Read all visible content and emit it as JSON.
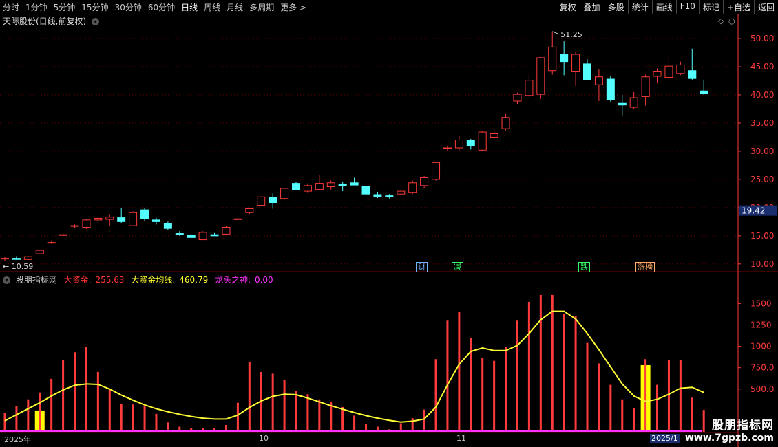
{
  "toolbar": {
    "periods": [
      "分时",
      "1分钟",
      "5分钟",
      "15分钟",
      "30分钟",
      "60分钟",
      "日线",
      "周线",
      "月线",
      "多周期",
      "更多 >"
    ],
    "active_period": "日线",
    "right_buttons": [
      "复权",
      "叠加",
      "多股",
      "统计",
      "画线",
      "F10",
      "标记",
      "+自选",
      "返回"
    ]
  },
  "chart_title": "天际股份(日线,前复权)",
  "indicator": {
    "name": "股朋指标网",
    "line1_label": "大资金:",
    "line1_value": "255.63",
    "line2_label": "大资金均线:",
    "line2_value": "460.79",
    "line3_label": "龙头之神:",
    "line3_value": "0.00"
  },
  "annotations": {
    "high": "51.25",
    "low": "10.59",
    "current_price": "19.42"
  },
  "event_tags": [
    "财",
    "减",
    "跌",
    "涨榜"
  ],
  "date_labels": [
    "2025年",
    "10",
    "11",
    "2025/1"
  ],
  "watermark": {
    "line1": "股朋指标网",
    "line2": "www.7gpzb.com"
  },
  "colors": {
    "up": "#ff3b3b",
    "down": "#54ffff",
    "line": "#ffff33",
    "highlight": "#ffff00",
    "axis": "#ff3b3b"
  },
  "chart_data": [
    {
      "type": "candlestick",
      "title": "天际股份(日线,前复权)",
      "yticks": [
        10,
        15,
        20,
        25,
        30,
        35,
        40,
        45,
        50
      ],
      "ylim": [
        9.0,
        52.2
      ],
      "ohlc": [
        [
          10.9,
          11.2,
          10.59,
          11.0
        ],
        [
          11.0,
          11.4,
          10.7,
          10.8
        ],
        [
          10.8,
          11.4,
          10.7,
          11.3
        ],
        [
          11.8,
          12.5,
          11.7,
          12.4
        ],
        [
          13.8,
          14.0,
          13.6,
          13.8
        ],
        [
          15.2,
          15.4,
          15.0,
          15.2
        ],
        [
          16.7,
          17.0,
          16.4,
          16.8
        ],
        [
          16.5,
          17.9,
          16.2,
          17.8
        ],
        [
          17.8,
          18.3,
          17.3,
          18.1
        ],
        [
          17.9,
          18.8,
          16.8,
          18.3
        ],
        [
          18.2,
          19.9,
          17.3,
          17.5
        ],
        [
          16.8,
          19.3,
          16.8,
          19.1
        ],
        [
          19.6,
          19.9,
          17.6,
          18.0
        ],
        [
          17.8,
          18.2,
          17.0,
          17.5
        ],
        [
          17.2,
          17.5,
          16.0,
          16.3
        ],
        [
          15.4,
          15.8,
          15.0,
          15.3
        ],
        [
          15.1,
          15.3,
          14.6,
          14.7
        ],
        [
          14.3,
          15.8,
          14.3,
          15.6
        ],
        [
          15.2,
          15.5,
          15.0,
          15.0
        ],
        [
          15.3,
          16.7,
          15.1,
          16.5
        ],
        [
          17.9,
          18.2,
          17.8,
          18.0
        ],
        [
          19.1,
          20.0,
          18.9,
          19.8
        ],
        [
          20.4,
          22.0,
          20.3,
          21.9
        ],
        [
          21.8,
          22.5,
          19.8,
          20.9
        ],
        [
          21.6,
          23.5,
          21.4,
          23.4
        ],
        [
          24.3,
          24.6,
          23.1,
          23.2
        ],
        [
          22.9,
          24.3,
          22.7,
          23.9
        ],
        [
          23.2,
          25.8,
          23.2,
          24.3
        ],
        [
          23.7,
          24.8,
          23.2,
          24.4
        ],
        [
          24.2,
          24.6,
          22.9,
          23.9
        ],
        [
          24.4,
          25.3,
          24.1,
          24.0
        ],
        [
          23.8,
          24.1,
          22.2,
          22.4
        ],
        [
          22.3,
          22.8,
          21.7,
          22.0
        ],
        [
          22.1,
          22.4,
          21.6,
          22.0
        ],
        [
          22.4,
          23.0,
          22.2,
          22.9
        ],
        [
          22.7,
          24.8,
          22.4,
          24.4
        ],
        [
          23.9,
          25.6,
          23.5,
          25.3
        ],
        [
          25.0,
          28.0,
          24.8,
          28.0
        ],
        [
          30.5,
          31.0,
          30.0,
          30.6
        ],
        [
          30.6,
          32.7,
          30.0,
          32.0
        ],
        [
          32.0,
          32.2,
          30.3,
          30.9
        ],
        [
          30.2,
          33.6,
          30.0,
          33.4
        ],
        [
          32.5,
          34.0,
          32.2,
          33.1
        ],
        [
          34.0,
          36.6,
          33.7,
          36.0
        ],
        [
          38.9,
          40.4,
          38.4,
          40.1
        ],
        [
          39.9,
          43.8,
          39.4,
          42.6
        ],
        [
          40.1,
          46.7,
          39.3,
          46.6
        ],
        [
          44.3,
          51.25,
          43.6,
          48.5
        ],
        [
          47.2,
          49.5,
          43.5,
          45.9
        ],
        [
          44.2,
          47.6,
          41.6,
          47.2
        ],
        [
          45.5,
          46.3,
          42.6,
          42.7
        ],
        [
          41.8,
          44.5,
          38.9,
          43.2
        ],
        [
          42.8,
          43.3,
          38.8,
          39.1
        ],
        [
          38.5,
          40.0,
          36.3,
          38.2
        ],
        [
          37.8,
          40.5,
          37.5,
          39.5
        ],
        [
          39.7,
          43.6,
          38.1,
          43.2
        ],
        [
          43.3,
          44.7,
          42.2,
          44.2
        ],
        [
          43.1,
          47.2,
          42.5,
          45.1
        ],
        [
          43.8,
          45.9,
          43.5,
          45.3
        ],
        [
          44.3,
          48.2,
          42.7,
          42.9
        ],
        [
          40.7,
          42.7,
          40.0,
          40.3
        ]
      ]
    },
    {
      "type": "bar+line",
      "series": [
        {
          "name": "大资金",
          "values": [
            220,
            300,
            380,
            460,
            620,
            840,
            930,
            990,
            700,
            500,
            330,
            320,
            300,
            210,
            110,
            60,
            45,
            40,
            40,
            80,
            340,
            820,
            700,
            680,
            610,
            480,
            440,
            380,
            350,
            290,
            190,
            90,
            60,
            30,
            100,
            160,
            260,
            850,
            1300,
            1400,
            1100,
            860,
            830,
            990,
            1300,
            1520,
            1600,
            1600,
            1380,
            1350,
            1040,
            800,
            550,
            380,
            280,
            850,
            550,
            840,
            840,
            400,
            255.63
          ]
        },
        {
          "name": "大资金均线",
          "values": [
            130,
            200,
            270,
            340,
            420,
            490,
            545,
            560,
            555,
            500,
            430,
            370,
            315,
            270,
            235,
            205,
            180,
            160,
            150,
            150,
            195,
            285,
            360,
            415,
            440,
            435,
            395,
            350,
            305,
            265,
            225,
            190,
            160,
            135,
            115,
            125,
            150,
            290,
            550,
            790,
            940,
            980,
            950,
            950,
            1010,
            1150,
            1310,
            1410,
            1410,
            1320,
            1150,
            960,
            760,
            560,
            420,
            355,
            380,
            440,
            510,
            520,
            460.79
          ]
        }
      ],
      "highlight_values": [
        250,
        780
      ],
      "yticks": [
        500,
        750,
        1000,
        1250,
        1500
      ],
      "ylim": [
        0,
        1720
      ]
    }
  ]
}
